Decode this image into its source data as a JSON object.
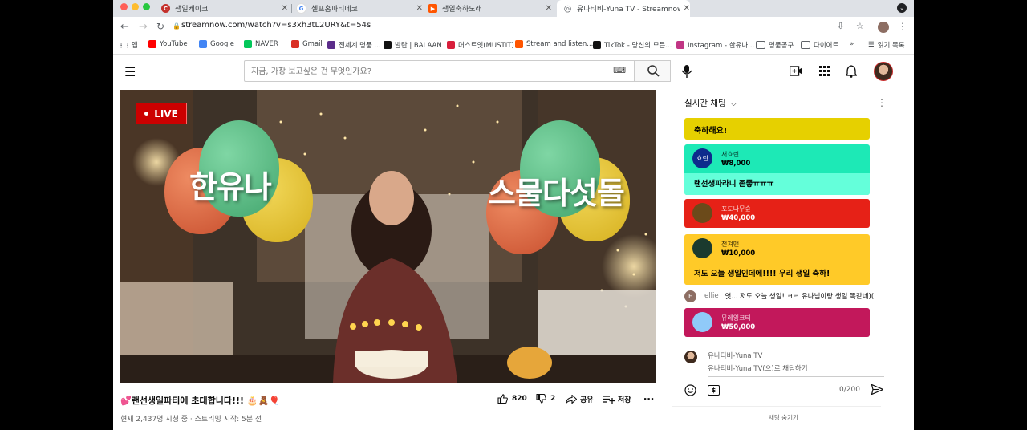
{
  "tabs": [
    {
      "label": "생일케이크",
      "favicon_color": "#c4302b",
      "favicon_glyph": "C"
    },
    {
      "label": "셀프홈파티데코",
      "favicon_color": "#4285f4",
      "favicon_glyph": "G"
    },
    {
      "label": "생일축하노래",
      "favicon_color": "#ff5500",
      "favicon_glyph": "▶"
    },
    {
      "label": "유나티비-Yuna TV - Streamnow",
      "favicon_color": "#5f6368",
      "favicon_glyph": "◎",
      "active": true
    }
  ],
  "url": "streamnow.com/watch?v=s3xh3tL2URY&t=54s",
  "bookmarks": [
    {
      "label": "앱",
      "icon": "apps-grid-icon",
      "color": "#5f6368"
    },
    {
      "label": "YouTube",
      "icon": "youtube-icon",
      "color": "#ff0000"
    },
    {
      "label": "Google",
      "icon": "google-icon",
      "color": "#4285f4"
    },
    {
      "label": "NAVER",
      "icon": "naver-icon",
      "color": "#03c75a"
    },
    {
      "label": "Gmail",
      "icon": "gmail-icon",
      "color": "#d93025"
    },
    {
      "label": "전세계 명품 ...",
      "icon": "shop-icon",
      "color": "#5b2c8a"
    },
    {
      "label": "발란 | BALAAN",
      "icon": "balaan-icon",
      "color": "#111111"
    },
    {
      "label": "머스트잇(MUSTIT)",
      "icon": "mustit-icon",
      "color": "#d81e3b"
    },
    {
      "label": "Stream and listen...",
      "icon": "soundcloud-icon",
      "color": "#ff5500"
    },
    {
      "label": "TikTok - 당신의 모든...",
      "icon": "tiktok-icon",
      "color": "#111111"
    },
    {
      "label": "Instagram - 한유나...",
      "icon": "instagram-icon",
      "color": "#c13584"
    },
    {
      "label": "명품공구",
      "icon": "folder-icon",
      "color": "#5f6368"
    },
    {
      "label": "다이어트",
      "icon": "folder-icon",
      "color": "#5f6368"
    }
  ],
  "bookmarks_more": "»",
  "reading_list": "읽기 목록",
  "search": {
    "placeholder": "지금, 가장 보고싶은 건 무엇인가요?"
  },
  "video": {
    "live_label": "LIVE",
    "overlay_left": "한유나",
    "overlay_right": "스물다섯돌",
    "title": "💕랜선생일파티에 초대합니다!!! 🎂🧸🎈",
    "meta": "현재 2,437명 시청 중 · 스트리밍 시작: 5분 전",
    "likes": "820",
    "dislikes": "2",
    "share": "공유",
    "save": "저장"
  },
  "chat": {
    "header": "실시간 채팅",
    "pinned": "축하해요!",
    "superchats": [
      {
        "name": "서효린",
        "amount": "₩8,000",
        "message": "랜선생파라니 존좋ㅠㅠㅠ",
        "top_color": "#1de9b6",
        "msg_color": "#64ffda",
        "avatar_color": "#0d2b8c",
        "avatar_text": "효린",
        "text_color": "#000000"
      },
      {
        "name": "포도나무숲",
        "amount": "₩40,000",
        "message": "",
        "top_color": "#e62117",
        "msg_color": "#e62117",
        "avatar_color": "#6b4a1a",
        "avatar_text": "",
        "text_color": "#ffffff"
      },
      {
        "name": "전져맨",
        "amount": "₩10,000",
        "message": "저도 오늘 생일인데에!!!! 우리 생일 축하!",
        "top_color": "#ffca28",
        "msg_color": "#ffca28",
        "avatar_color": "#1b3a2e",
        "avatar_text": "",
        "text_color": "#000000"
      },
      {
        "name": "뮤레잉크티",
        "amount": "₩50,000",
        "message": "",
        "top_color": "#c2185b",
        "msg_color": "#c2185b",
        "avatar_color": "#90caf9",
        "avatar_text": "",
        "text_color": "#ffffff"
      }
    ],
    "regular": {
      "author": "ellie",
      "initial": "E",
      "text": "엇... 저도 오늘 생일! ㅋㅋ 유나님이랑 생일 똑같네)("
    },
    "input_user": "유나티비-Yuna TV",
    "input_placeholder": "유나티비-Yuna TV(으)로 채팅하기",
    "counter": "0/200",
    "hide_label": "채팅 숨기기"
  }
}
